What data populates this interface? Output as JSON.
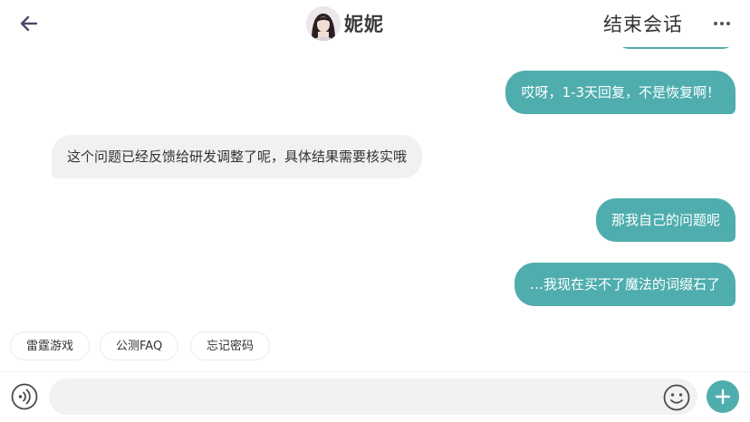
{
  "header": {
    "title": "妮妮",
    "end_chat_label": "结束会话",
    "back_icon": "arrow-left-icon",
    "more_icon": "more-dots-icon"
  },
  "messages": [
    {
      "sender": "me",
      "text": "哎呀，1-3天回复，不是恢复啊！"
    },
    {
      "sender": "agent",
      "text": "这个问题已经反馈给研发调整了呢，具体结果需要核实哦"
    },
    {
      "sender": "me",
      "text": "那我自己的问题呢"
    },
    {
      "sender": "me",
      "text": "…我现在买不了魔法的词缀石了"
    }
  ],
  "quick_replies": [
    "雷霆游戏",
    "公测FAQ",
    "忘记密码"
  ],
  "input": {
    "value": "",
    "placeholder": ""
  },
  "colors": {
    "accent": "#4fadad",
    "incoming_bubble": "#f1f1f1",
    "text": "#333333"
  }
}
